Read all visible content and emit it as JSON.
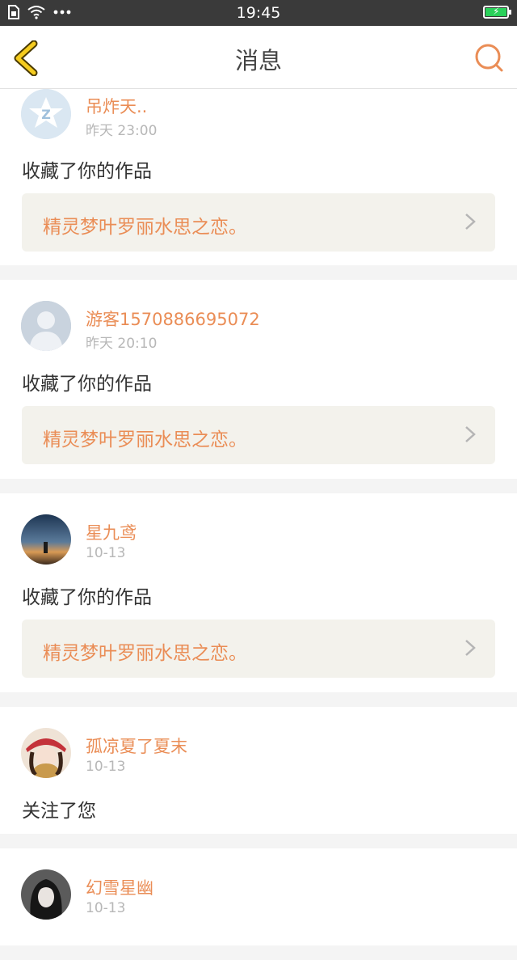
{
  "status_bar": {
    "time": "19:45"
  },
  "header": {
    "title": "消息"
  },
  "messages": [
    {
      "name": "吊炸天..",
      "time": "昨天 23:00",
      "action": "收藏了你的作品",
      "work_title": "精灵梦叶罗丽水思之恋。"
    },
    {
      "name": "游客1570886695072",
      "time": "昨天 20:10",
      "action": "收藏了你的作品",
      "work_title": "精灵梦叶罗丽水思之恋。"
    },
    {
      "name": "星九鸢",
      "time": "10-13",
      "action": "收藏了你的作品",
      "work_title": "精灵梦叶罗丽水思之恋。"
    },
    {
      "name": "孤凉夏了夏末",
      "time": "10-13",
      "action": "关注了您"
    },
    {
      "name": "幻雪星幽",
      "time": "10-13"
    }
  ],
  "colors": {
    "accent": "#ea8d56",
    "back_arrow": "#f5cc1f",
    "status_bar": "#3a3a3a"
  }
}
